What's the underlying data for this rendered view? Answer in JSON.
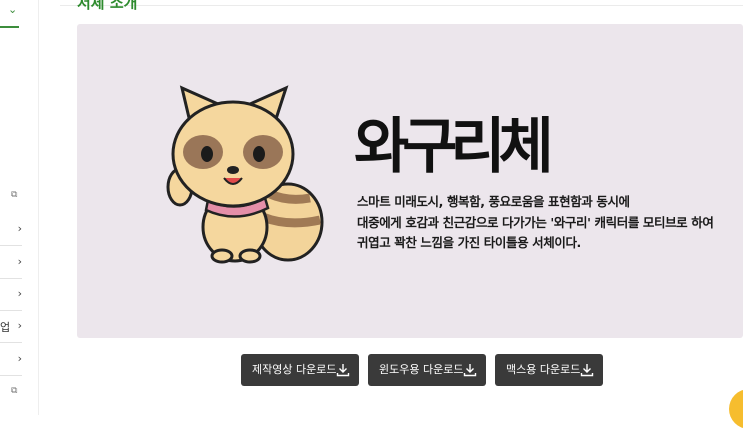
{
  "section_title": "서체 소개",
  "sidebar": {
    "items": [
      {
        "partial": "",
        "arrow": "›"
      },
      {
        "partial": "",
        "arrow": "›"
      },
      {
        "partial": "",
        "arrow": "›"
      },
      {
        "partial": "업",
        "arrow": "›"
      },
      {
        "partial": "",
        "arrow": "›"
      }
    ],
    "top_chevron": "⌄",
    "ext_icon": "⧉"
  },
  "banner": {
    "logo_text": "와구리체",
    "description": [
      "스마트 미래도시, 행복함, 풍요로움을 표현함과 동시에",
      "대중에게 호감과 친근감으로 다가가는 '와구리' 캐릭터를 모티브로 하여",
      "귀엽고 꽉찬 느낌을 가진 타이틀용 서체이다."
    ]
  },
  "buttons": [
    {
      "label": "제작영상 다운로드",
      "icon": "download-icon"
    },
    {
      "label": "윈도우용 다운로드",
      "icon": "download-icon"
    },
    {
      "label": "맥스용 다운로드",
      "icon": "download-icon"
    }
  ],
  "colors": {
    "accent": "#2e8b2e",
    "banner_bg": "#ece6ec",
    "button_bg": "#3a3a3a",
    "fab": "#f6bd2e"
  }
}
